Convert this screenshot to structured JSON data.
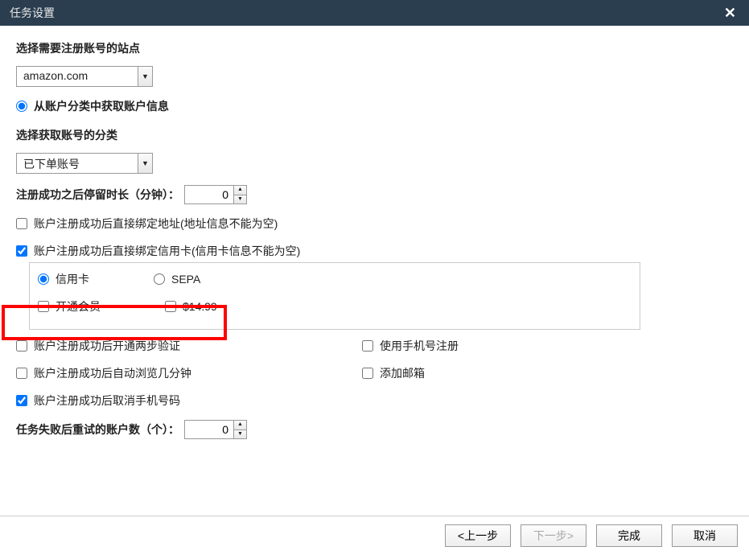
{
  "titlebar": {
    "title": "任务设置"
  },
  "labels": {
    "site_select": "选择需要注册账号的站点",
    "from_category": "从账户分类中获取账户信息",
    "category_select": "选择获取账号的分类",
    "stay_duration": "注册成功之后停留时长（分钟）：",
    "retry_count": "任务失败后重试的账户数（个）："
  },
  "dropdowns": {
    "site": "amazon.com",
    "category": "已下单账号"
  },
  "spinners": {
    "stay_duration": "0",
    "retry_count": "0"
  },
  "checkboxes": {
    "bind_address": "账户注册成功后直接绑定地址(地址信息不能为空)",
    "bind_card": "账户注册成功后直接绑定信用卡(信用卡信息不能为空)",
    "open_member": "开通会员",
    "price": "$14.99",
    "two_step": "账户注册成功后开通两步验证",
    "use_phone": "使用手机号注册",
    "auto_browse": "账户注册成功后自动浏览几分钟",
    "add_email": "添加邮箱",
    "cancel_phone": "账户注册成功后取消手机号码"
  },
  "radios": {
    "credit_card": "信用卡",
    "sepa": "SEPA"
  },
  "buttons": {
    "prev": "<上一步",
    "next": "下一步>",
    "finish": "完成",
    "cancel": "取消"
  }
}
